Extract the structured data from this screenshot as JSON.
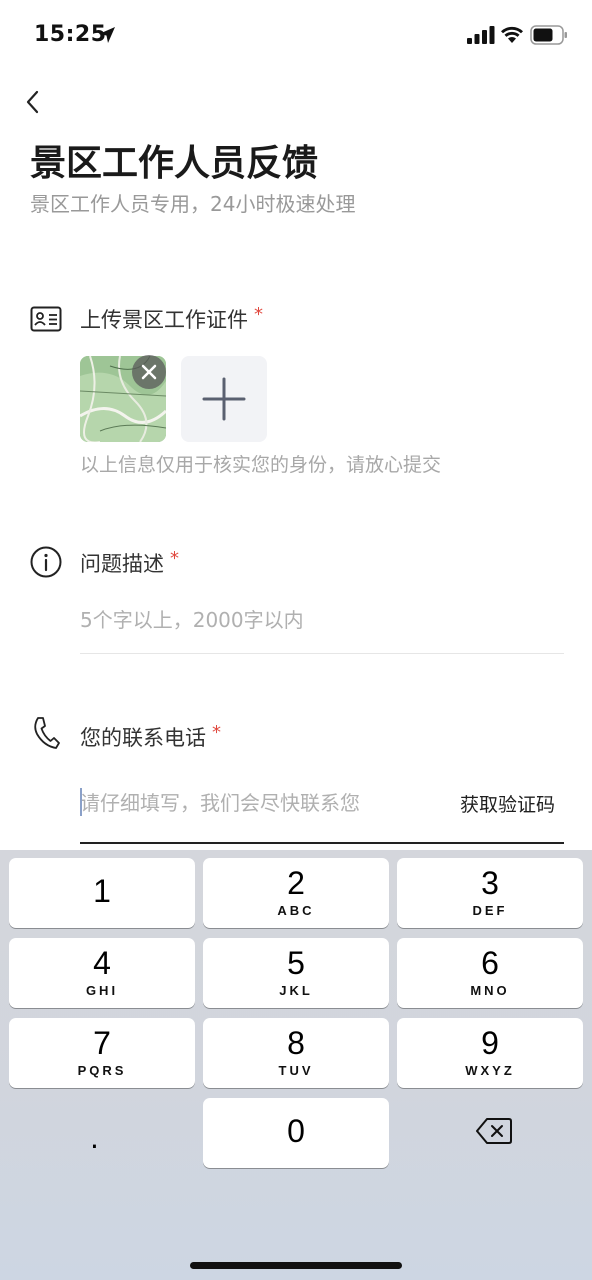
{
  "status_bar": {
    "time": "15:25"
  },
  "header": {
    "title": "景区工作人员反馈",
    "subtitle": "景区工作人员专用，24小时极速处理"
  },
  "upload_section": {
    "label": "上传景区工作证件",
    "required_mark": "*",
    "hint": "以上信息仅用于核实您的身份，请放心提交",
    "icon": "id-card-icon"
  },
  "description_section": {
    "label": "问题描述",
    "required_mark": "*",
    "placeholder": "5个字以上，2000字以内",
    "icon": "info-icon"
  },
  "phone_section": {
    "label": "您的联系电话",
    "required_mark": "*",
    "placeholder": "请仔细填写，我们会尽快联系您",
    "value": "",
    "get_code_label": "获取验证码",
    "icon": "phone-icon"
  },
  "keyboard": {
    "keys": [
      {
        "num": "1",
        "letters": ""
      },
      {
        "num": "2",
        "letters": "ABC"
      },
      {
        "num": "3",
        "letters": "DEF"
      },
      {
        "num": "4",
        "letters": "GHI"
      },
      {
        "num": "5",
        "letters": "JKL"
      },
      {
        "num": "6",
        "letters": "MNO"
      },
      {
        "num": "7",
        "letters": "PQRS"
      },
      {
        "num": "8",
        "letters": "TUV"
      },
      {
        "num": "9",
        "letters": "WXYZ"
      },
      {
        "num": "0",
        "letters": ""
      }
    ],
    "dot_label": ".",
    "delete_icon": "backspace-icon"
  },
  "colors": {
    "required": "#e0483e",
    "keyboard_bg": "#d4d6dc",
    "placeholder": "#b0b0b0"
  }
}
